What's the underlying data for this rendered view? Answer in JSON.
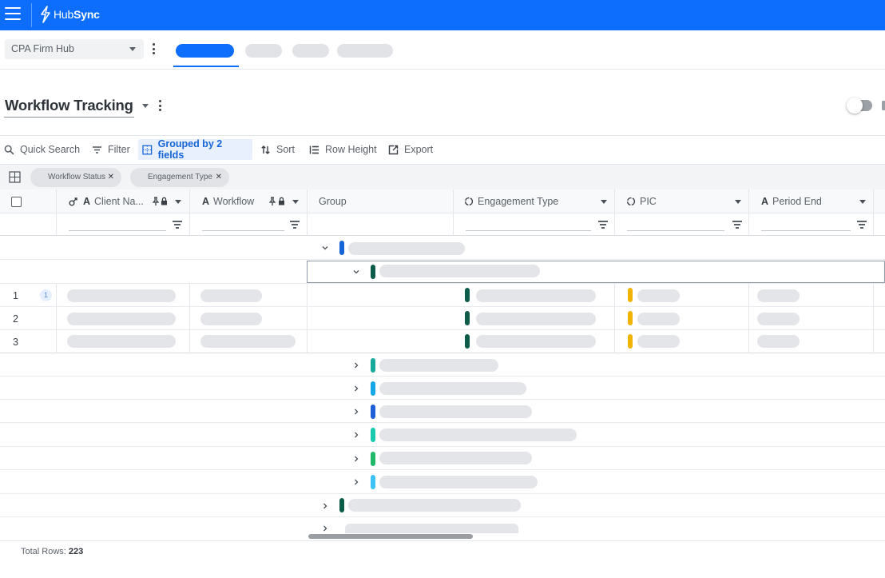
{
  "app": {
    "brand_prefix": "Hub",
    "brand_suffix": "Sync",
    "brand_color": "#0d6efd"
  },
  "hub": {
    "selected": "CPA Firm Hub"
  },
  "tabs": [
    {
      "color": "#0d6efd",
      "active": true
    },
    {
      "color": "#e2e3e6",
      "active": false
    },
    {
      "color": "#e2e3e6",
      "active": false
    },
    {
      "color": "#e2e3e6",
      "active": false
    }
  ],
  "view": {
    "title": "Workflow Tracking"
  },
  "toolbar": {
    "quick_search": "Quick Search",
    "filter": "Filter",
    "grouped": "Grouped by 2 fields",
    "sort": "Sort",
    "row_height": "Row Height",
    "export": "Export"
  },
  "group_chips": [
    "Workflow Status",
    "Engagement Type"
  ],
  "columns": {
    "client_name": "Client Na...",
    "workflow": "Workflow",
    "group": "Group",
    "engagement_type": "Engagement Type",
    "pic": "PIC",
    "period_end": "Period End"
  },
  "rows": [
    {
      "num": "1",
      "badge": "1"
    },
    {
      "num": "2"
    },
    {
      "num": "3"
    }
  ],
  "group_colors": {
    "level1": "#1565d8",
    "level2": "#0d5c4a",
    "engagement_marker": "#0d5c4a",
    "pic_marker": "#f0b400",
    "sub_groups": [
      "#17a99a",
      "#17a6e6",
      "#1f5fd6",
      "#19c9b0",
      "#22b86a",
      "#3cc2f5"
    ],
    "collapsed_group": "#0d5c4a"
  },
  "footer": {
    "label": "Total Rows:",
    "count": "223"
  }
}
